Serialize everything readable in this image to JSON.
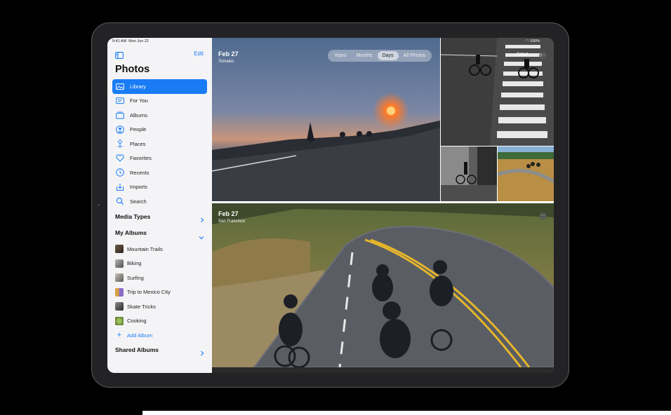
{
  "status_bar": {
    "time": "9:41 AM",
    "date": "Mon Jun 22",
    "battery": "100%"
  },
  "sidebar": {
    "edit_label": "Edit",
    "title": "Photos",
    "nav_items": [
      {
        "label": "Library",
        "icon": "photo-library-icon",
        "active": true
      },
      {
        "label": "For You",
        "icon": "for-you-icon"
      },
      {
        "label": "Albums",
        "icon": "albums-icon"
      },
      {
        "label": "People",
        "icon": "people-icon"
      },
      {
        "label": "Places",
        "icon": "places-icon"
      },
      {
        "label": "Favorites",
        "icon": "heart-icon"
      },
      {
        "label": "Recents",
        "icon": "clock-icon"
      },
      {
        "label": "Imports",
        "icon": "import-icon"
      },
      {
        "label": "Search",
        "icon": "search-icon"
      }
    ],
    "media_types_label": "Media Types",
    "my_albums_label": "My Albums",
    "albums": [
      {
        "label": "Mountain Trails"
      },
      {
        "label": "Biking"
      },
      {
        "label": "Surfing"
      },
      {
        "label": "Trip to Mexico City"
      },
      {
        "label": "Skate Tricks"
      },
      {
        "label": "Cooking"
      }
    ],
    "add_album_label": "Add Album",
    "shared_albums_label": "Shared Albums"
  },
  "main": {
    "segments": [
      "Years",
      "Months",
      "Days",
      "All Photos"
    ],
    "active_segment": "Days",
    "select_label": "Select",
    "days": [
      {
        "date": "Feb 27",
        "place": "Tomales"
      },
      {
        "date": "Feb 27",
        "place": "San Francisco"
      }
    ]
  },
  "colors": {
    "accent": "#1a7cf5",
    "sidebar_bg": "#f4f4f6"
  }
}
